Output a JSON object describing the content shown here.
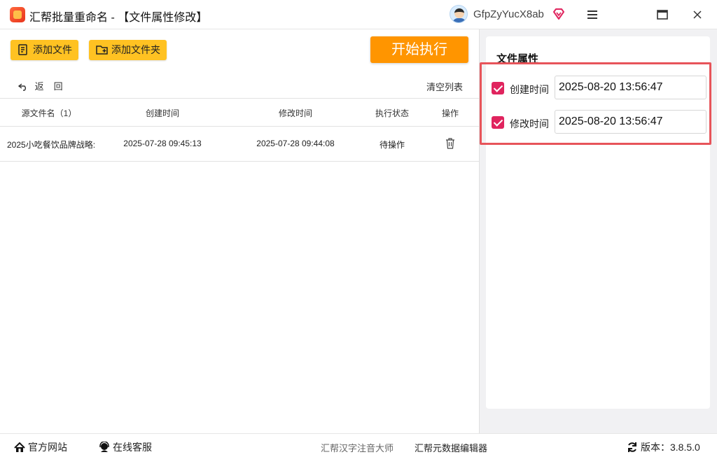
{
  "app": {
    "title": "汇帮批量重命名 - 【文件属性修改】",
    "username": "GfpZyYucX8ab"
  },
  "toolbar": {
    "add_file_label": "添加文件",
    "add_folder_label": "添加文件夹",
    "start_label": "开始执行",
    "back_label": "返回",
    "clear_list_label": "清空列表"
  },
  "table": {
    "headers": {
      "name": "源文件名（1）",
      "ctime": "创建时间",
      "mtime": "修改时间",
      "status": "执行状态",
      "op": "操作"
    },
    "rows": [
      {
        "name": "2025小吃餐饮品牌战略:",
        "ctime": "2025-07-28 09:45:13",
        "mtime": "2025-07-28 09:44:08",
        "status": "待操作"
      }
    ]
  },
  "attributes": {
    "title": "文件属性",
    "create_time": {
      "label": "创建时间",
      "checked": true,
      "value": "2025-08-20 13:56:47"
    },
    "modify_time": {
      "label": "修改时间",
      "checked": true,
      "value": "2025-08-20 13:56:47"
    }
  },
  "footer": {
    "website": "官方网站",
    "support": "在线客服",
    "link1": "汇帮汉字注音大师",
    "link2": "汇帮元数据编辑器",
    "version_label": "版本：3.8.5.0"
  },
  "colors": {
    "accent_yellow": "#ffc222",
    "start_orange": "#ff9500",
    "checkbox_pink": "#e0245e",
    "highlight_red": "#e7545a"
  }
}
